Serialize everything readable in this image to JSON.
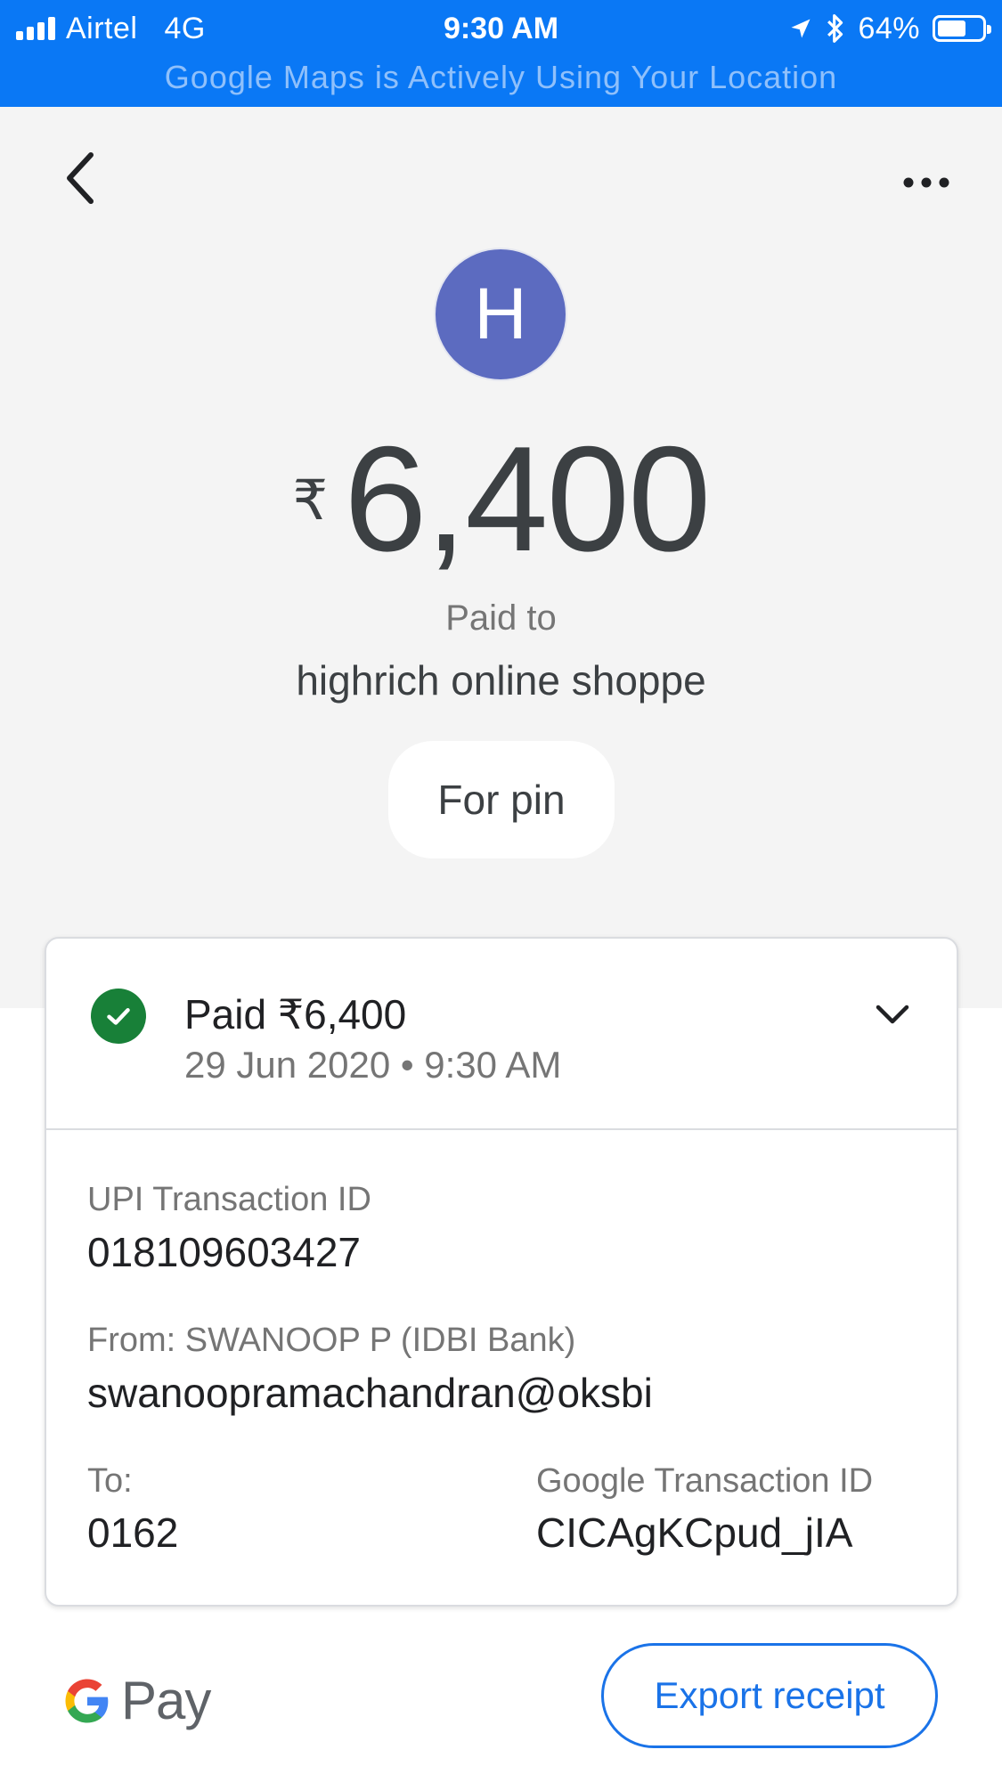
{
  "status_bar": {
    "carrier": "Airtel",
    "network": "4G",
    "time": "9:30 AM",
    "battery": "64%",
    "battery_level": 0.64,
    "banner": "Google Maps is Actively Using Your Location"
  },
  "header": {
    "avatar_initial": "H",
    "currency_symbol": "₹",
    "amount": "6,400",
    "paid_to_label": "Paid to",
    "payee": "highrich online shoppe",
    "note": "For pin"
  },
  "details": {
    "status_title": "Paid ₹6,400",
    "status_datetime": "29 Jun 2020 • 9:30 AM",
    "upi_label": "UPI Transaction ID",
    "upi_value": "018109603427",
    "from_label": "From: SWANOOP P (IDBI Bank)",
    "from_value": "swanoopramachandran@oksbi",
    "to_label": "To:",
    "to_value": "0162",
    "google_txn_label": "Google Transaction ID",
    "google_txn_value": "CICAgKCpud_jIA"
  },
  "footer": {
    "brand_word": "Pay",
    "export_label": "Export receipt"
  },
  "icons": {
    "back": "back-arrow-icon",
    "more": "more-options-icon",
    "check": "check-circle-icon",
    "expand": "chevron-down-icon",
    "location": "location-arrow-icon",
    "bluetooth": "bluetooth-icon"
  },
  "colors": {
    "status_bar": "#0a78f5",
    "avatar": "#5c6bc0",
    "success": "#188038",
    "accent": "#1a73e8"
  }
}
